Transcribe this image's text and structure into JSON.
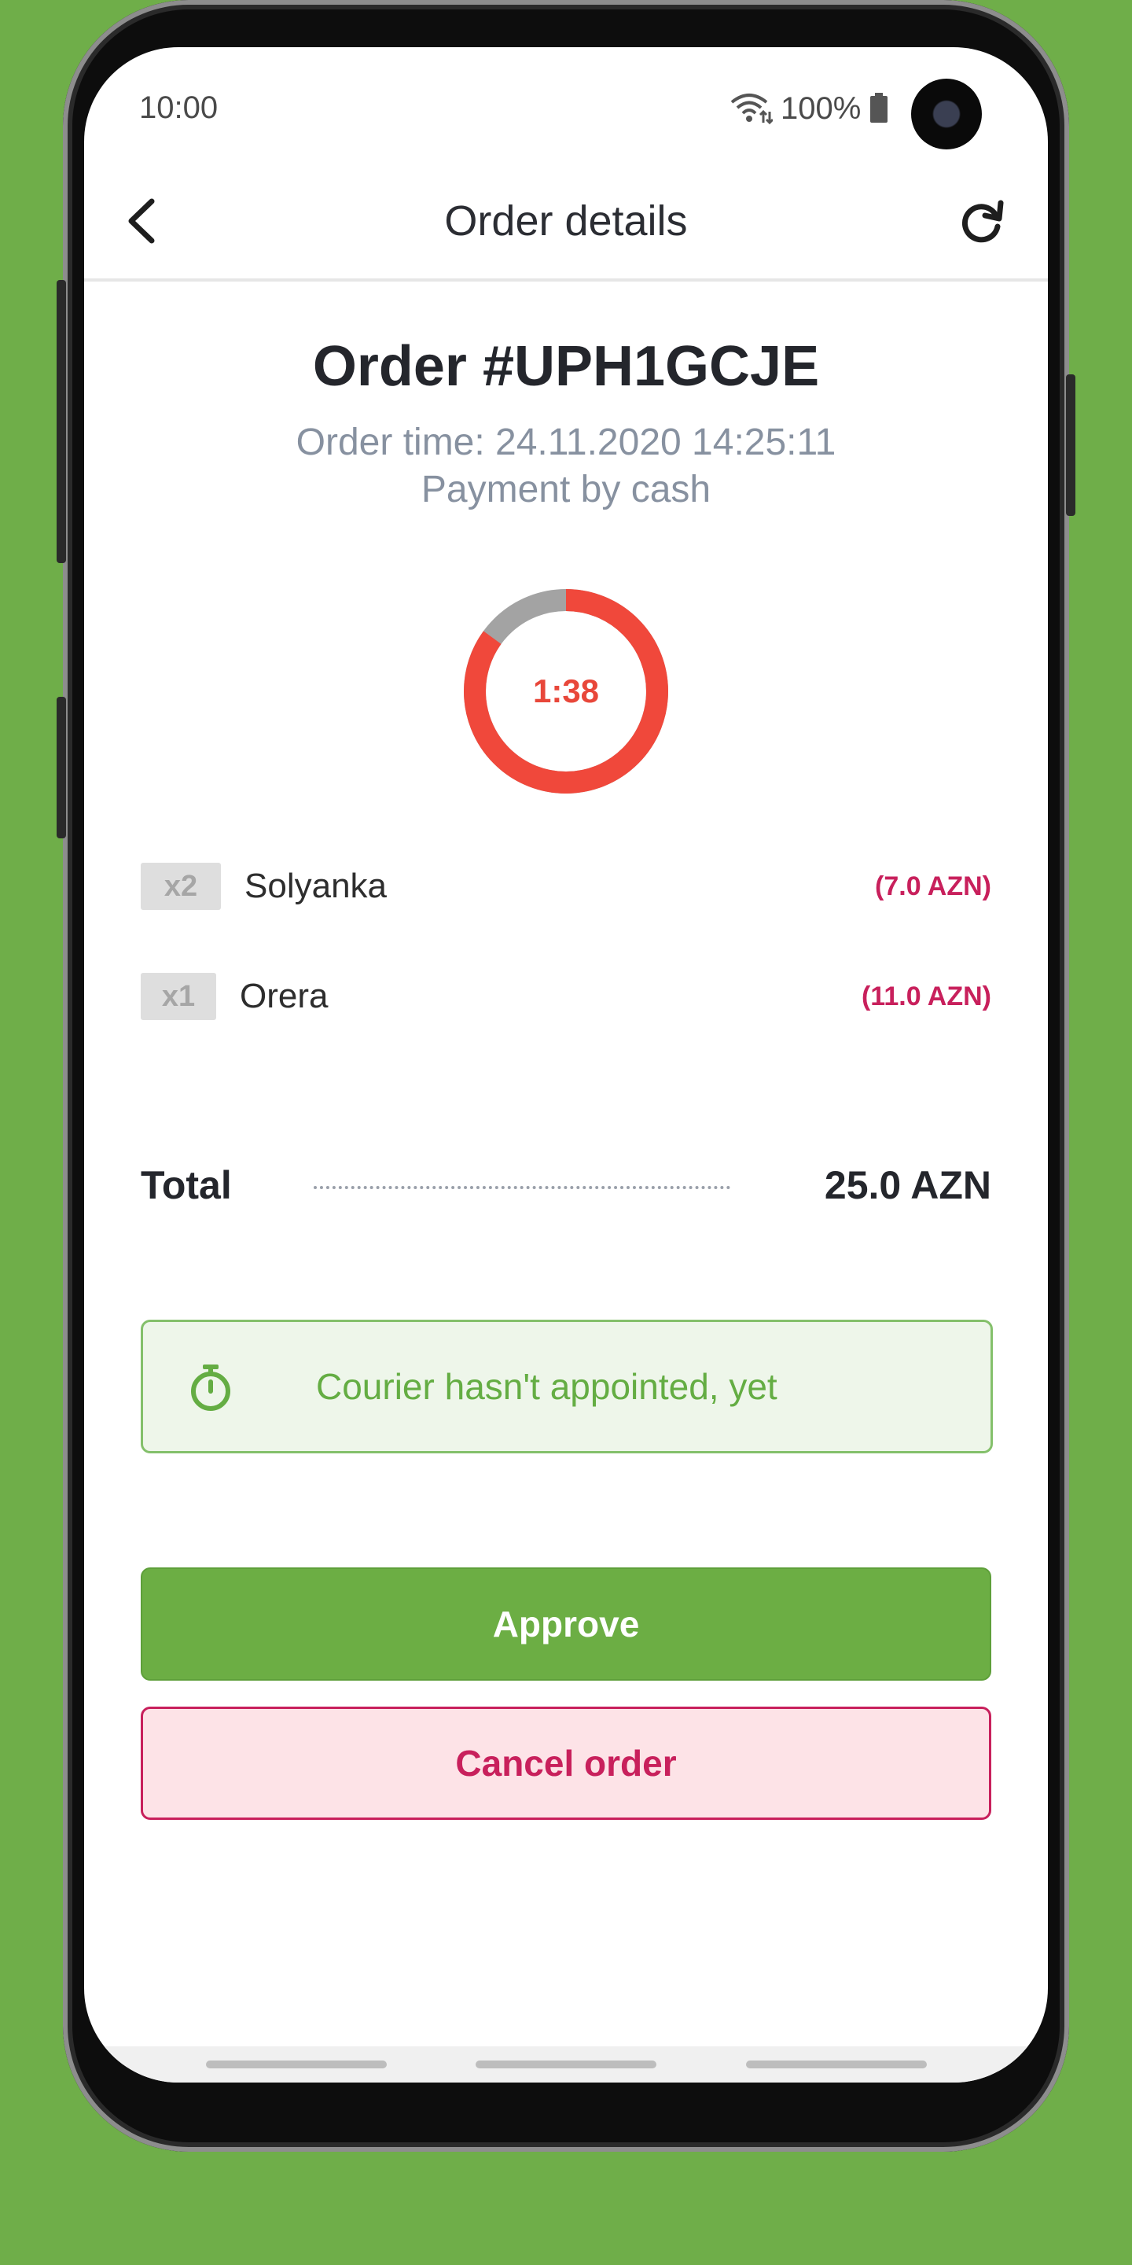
{
  "status_bar": {
    "time": "10:00",
    "battery": "100%"
  },
  "app_bar": {
    "title": "Order details",
    "back_icon": "chevron-left-icon",
    "refresh_icon": "refresh-icon"
  },
  "order": {
    "title": "Order #UPH1GCJE",
    "time": "Order time: 24.11.2020 14:25:11",
    "payment": "Payment by cash"
  },
  "timer": {
    "label": "1:38",
    "remaining_fraction": 0.85,
    "colors": {
      "remaining": "#f0483b",
      "elapsed": "#a3a3a3"
    }
  },
  "items": [
    {
      "qty": "x2",
      "name": "Solyanka",
      "price": "(7.0 AZN)"
    },
    {
      "qty": "x1",
      "name": "Orera",
      "price": "(11.0 AZN)"
    }
  ],
  "total": {
    "label": "Total",
    "value": "25.0 AZN"
  },
  "courier": {
    "icon": "stopwatch-icon",
    "message": "Courier hasn't appointed, yet"
  },
  "actions": {
    "approve_label": "Approve",
    "cancel_label": "Cancel order"
  },
  "colors": {
    "background": "#6fae49",
    "accent_green": "#6cae44",
    "accent_red": "#c8205c"
  }
}
